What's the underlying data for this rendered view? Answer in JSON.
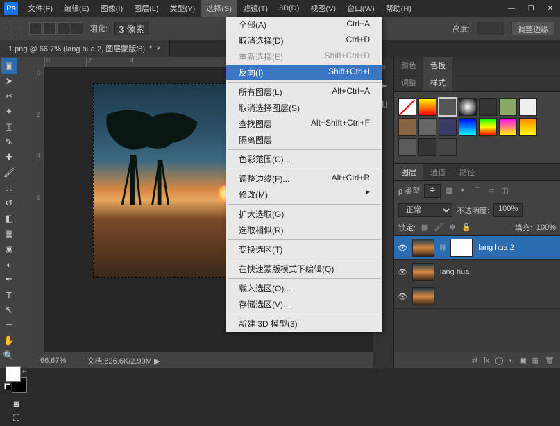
{
  "menubar": {
    "items": [
      "文件(F)",
      "编辑(E)",
      "图像(I)",
      "图层(L)",
      "类型(Y)",
      "选择(S)",
      "滤镜(T)",
      "3D(D)",
      "视图(V)",
      "窗口(W)",
      "帮助(H)"
    ],
    "open_index": 5
  },
  "window": {
    "min": "—",
    "restore": "❐",
    "close": "✕"
  },
  "options": {
    "feather_label": "羽化:",
    "feather_value": "3 像素",
    "height_label": "高度:",
    "refine": "调整边缘"
  },
  "doc_tab": {
    "title": "1.png @ 66.7% (lang hua 2, 图层蒙版/8)",
    "close": "×",
    "new": "*"
  },
  "dropdown": [
    {
      "label": "全部(A)",
      "shortcut": "Ctrl+A"
    },
    {
      "label": "取消选择(D)",
      "shortcut": "Ctrl+D"
    },
    {
      "label": "重新选择(E)",
      "shortcut": "Shift+Ctrl+D",
      "disabled": true
    },
    {
      "label": "反向(I)",
      "shortcut": "Shift+Ctrl+I",
      "hl": true
    },
    {
      "sep": true
    },
    {
      "label": "所有图层(L)",
      "shortcut": "Alt+Ctrl+A"
    },
    {
      "label": "取消选择图层(S)"
    },
    {
      "label": "查找图层",
      "shortcut": "Alt+Shift+Ctrl+F"
    },
    {
      "label": "隔离图层"
    },
    {
      "sep": true
    },
    {
      "label": "色彩范围(C)..."
    },
    {
      "sep": true
    },
    {
      "label": "调整边缘(F)...",
      "shortcut": "Alt+Ctrl+R"
    },
    {
      "label": "修改(M)",
      "sub": true
    },
    {
      "sep": true
    },
    {
      "label": "扩大选取(G)"
    },
    {
      "label": "选取相似(R)"
    },
    {
      "sep": true
    },
    {
      "label": "变换选区(T)"
    },
    {
      "sep": true
    },
    {
      "label": "在快速蒙版模式下编辑(Q)"
    },
    {
      "sep": true
    },
    {
      "label": "载入选区(O)..."
    },
    {
      "label": "存储选区(V)..."
    },
    {
      "sep": true
    },
    {
      "label": "新建 3D 模型(3)"
    }
  ],
  "panels": {
    "color": "颜色",
    "swatches": "色板",
    "adjust": "调整",
    "styles": "样式"
  },
  "styles_palette": [
    {
      "none": true
    },
    {
      "c": "linear-gradient(#ff0,#f00)"
    },
    {
      "c": "#555",
      "sel": true
    },
    {
      "c": "radial-gradient(#fff,#000)"
    },
    {
      "c": "#333"
    },
    {
      "c": "#8a6"
    },
    {
      "c": "#eee"
    },
    {
      "c": "#876543"
    },
    {
      "c": "#666"
    },
    {
      "c": "#3a3a66"
    },
    {
      "c": "linear-gradient(#00f,#0ff)"
    },
    {
      "c": "linear-gradient(#0f0,#ff0,#f00)"
    },
    {
      "c": "linear-gradient(#f0f,#ff0)"
    },
    {
      "c": "linear-gradient(#f80,#ff0)"
    },
    {
      "c": "#5a5a5a"
    },
    {
      "c": "#333 url()"
    },
    {
      "c": "#444"
    }
  ],
  "layers_panel": {
    "tabs": {
      "layers": "图层",
      "channels": "通道",
      "paths": "路径"
    },
    "kind_label": "ρ 类型",
    "kind_sel": "≑",
    "blend": "正常",
    "opacity_label": "不透明度:",
    "opacity": "100%",
    "lock_label": "锁定:",
    "fill_label": "填充:",
    "fill": "100%",
    "layers": [
      {
        "name": "lang hua 2",
        "mask": true,
        "active": true
      },
      {
        "name": "lang hua"
      },
      {
        "name": ""
      }
    ]
  },
  "status": {
    "zoom": "66.67%",
    "docinfo": "文档:826.6K/2.99M",
    "arrow": "▶"
  },
  "rulers": {
    "h": [
      "0",
      "2",
      "4"
    ],
    "v": [
      "0",
      "2",
      "4",
      "6"
    ]
  }
}
